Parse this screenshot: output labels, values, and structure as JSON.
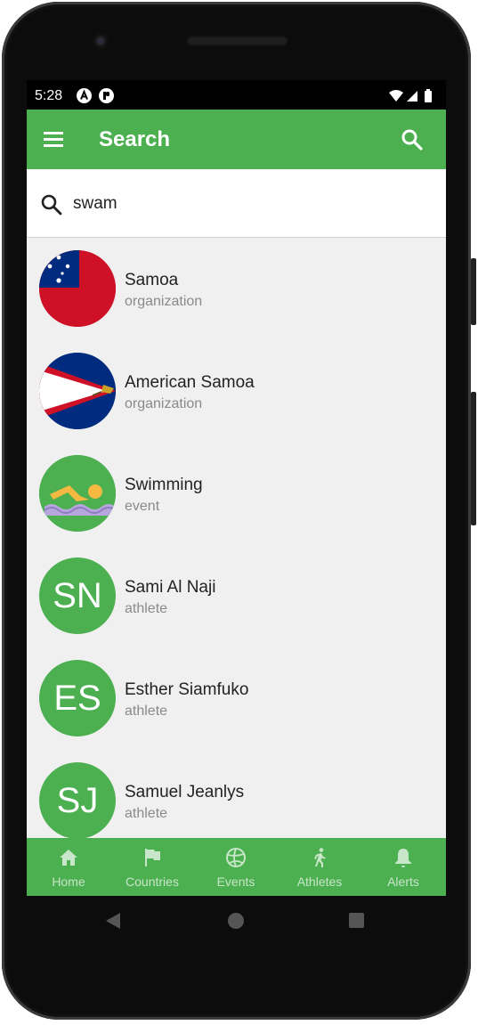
{
  "status": {
    "time": "5:28",
    "left_icons": [
      "notification-a-icon",
      "notification-p-icon"
    ],
    "right_icons": [
      "wifi-icon",
      "signal-icon",
      "battery-icon"
    ]
  },
  "appbar": {
    "title": "Search",
    "menu_icon": "hamburger-menu-icon",
    "action_icon": "search-icon",
    "color": "#4caf50"
  },
  "search": {
    "value": "swam",
    "placeholder": ""
  },
  "results": [
    {
      "name": "Samoa",
      "type": "organization",
      "avatar": "samoa-flag"
    },
    {
      "name": "American Samoa",
      "type": "organization",
      "avatar": "american-samoa-flag"
    },
    {
      "name": "Swimming",
      "type": "event",
      "avatar": "swimmer-icon"
    },
    {
      "name": "Sami Al Naji",
      "type": "athlete",
      "initials": "SN"
    },
    {
      "name": "Esther Siamfuko",
      "type": "athlete",
      "initials": "ES"
    },
    {
      "name": "Samuel Jeanlys",
      "type": "athlete",
      "initials": "SJ"
    }
  ],
  "bottom_nav": [
    {
      "label": "Home",
      "icon": "home-icon"
    },
    {
      "label": "Countries",
      "icon": "flag-icon"
    },
    {
      "label": "Events",
      "icon": "volleyball-icon"
    },
    {
      "label": "Athletes",
      "icon": "runner-icon"
    },
    {
      "label": "Alerts",
      "icon": "bell-icon"
    }
  ],
  "system_nav": {
    "icons": [
      "back-icon",
      "home-circle-icon",
      "recents-icon"
    ]
  }
}
